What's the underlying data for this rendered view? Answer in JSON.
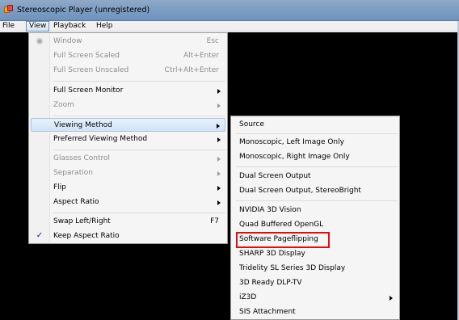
{
  "window": {
    "title": "Stereoscopic Player (unregistered)"
  },
  "menubar": {
    "file": "File",
    "view": "View",
    "playback": "Playback",
    "help": "Help"
  },
  "view_menu": {
    "items": [
      {
        "label": "Window",
        "shortcut": "Esc",
        "disabled": true
      },
      {
        "label": "Full Screen Scaled",
        "shortcut": "Alt+Enter",
        "disabled": true
      },
      {
        "label": "Full Screen Unscaled",
        "shortcut": "Ctrl+Alt+Enter",
        "disabled": true
      },
      {
        "label": "Full Screen Monitor",
        "submenu": true
      },
      {
        "label": "Zoom",
        "submenu": true,
        "disabled": true
      },
      {
        "label": "Viewing Method",
        "submenu": true,
        "highlighted": true
      },
      {
        "label": "Preferred Viewing Method",
        "submenu": true
      },
      {
        "label": "Glasses Control",
        "submenu": true,
        "disabled": true
      },
      {
        "label": "Separation",
        "submenu": true,
        "disabled": true
      },
      {
        "label": "Flip",
        "submenu": true
      },
      {
        "label": "Aspect Ratio",
        "submenu": true
      },
      {
        "label": "Swap Left/Right",
        "shortcut": "F7"
      },
      {
        "label": "Keep Aspect Ratio",
        "checked": true
      }
    ]
  },
  "viewing_method_submenu": {
    "items": [
      {
        "label": "Source"
      },
      {
        "label": "Monoscopic, Left Image Only"
      },
      {
        "label": "Monoscopic, Right Image Only"
      },
      {
        "label": "Dual Screen Output"
      },
      {
        "label": "Dual Screen Output, StereoBright"
      },
      {
        "label": "NVIDIA 3D Vision"
      },
      {
        "label": "Quad Buffered OpenGL"
      },
      {
        "label": "Software Pageflipping",
        "annotated": true
      },
      {
        "label": "SHARP 3D Display"
      },
      {
        "label": "Tridelity SL Series 3D Display"
      },
      {
        "label": "3D Ready DLP-TV"
      },
      {
        "label": "iZ3D",
        "submenu": true
      },
      {
        "label": "SIS Attachment"
      }
    ]
  },
  "colors": {
    "highlight_border": "#a8c4e3",
    "annotation": "#e40d0d",
    "video_background": "#000000"
  }
}
